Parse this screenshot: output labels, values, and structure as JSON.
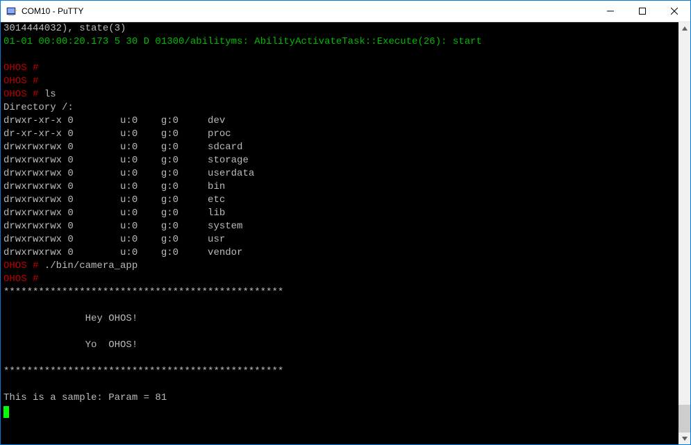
{
  "window": {
    "title": "COM10 - PuTTY"
  },
  "terminal": {
    "line1": "3014444032), state(3)",
    "line2": "01-01 00:00:20.173 5 30 D 01300/abilityms: AbilityActivateTask::Execute(26): start",
    "blank": "",
    "prompt": "OHOS # ",
    "cmd_ls": "ls",
    "dir_header": "Directory /:",
    "dir_rows": [
      {
        "perm": "drwxr-xr-x 0        u:0    g:0     dev"
      },
      {
        "perm": "dr-xr-xr-x 0        u:0    g:0     proc"
      },
      {
        "perm": "drwxrwxrwx 0        u:0    g:0     sdcard"
      },
      {
        "perm": "drwxrwxrwx 0        u:0    g:0     storage"
      },
      {
        "perm": "drwxrwxrwx 0        u:0    g:0     userdata"
      },
      {
        "perm": "drwxrwxrwx 0        u:0    g:0     bin"
      },
      {
        "perm": "drwxrwxrwx 0        u:0    g:0     etc"
      },
      {
        "perm": "drwxrwxrwx 0        u:0    g:0     lib"
      },
      {
        "perm": "drwxrwxrwx 0        u:0    g:0     system"
      },
      {
        "perm": "drwxrwxrwx 0        u:0    g:0     usr"
      },
      {
        "perm": "drwxrwxrwx 0        u:0    g:0     vendor"
      }
    ],
    "cmd_camera": "./bin/camera_app",
    "stars": "************************************************",
    "hey": "              Hey OHOS!",
    "yo": "              Yo  OHOS!",
    "sample": "This is a sample: Param = 81"
  }
}
